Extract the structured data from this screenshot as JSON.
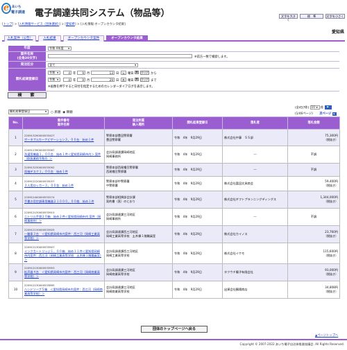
{
  "header": {
    "logo_letter": "e",
    "logo_small": "あいち",
    "logo_text": "電子調達",
    "system_title": "電子調達共同システム（物品等）",
    "font_larger": "文字を大きく",
    "font_standard": "標　準",
    "font_smaller": "文字を小さく"
  },
  "breadcrumbs": {
    "items": [
      "トップ",
      "入札情報サービス（団体選択）",
      "愛知県"
    ],
    "current": "入札情報-オープンカウンタ結果",
    "separator": " > "
  },
  "prefecture": "愛知県",
  "tabs": [
    "入札案件（公告）",
    "入札結果",
    "オープンカウンタ案件",
    "オープンカウンタ結果"
  ],
  "active_tab": 3,
  "form": {
    "nendo_label": "年度",
    "nendo_value": "令和 4年度",
    "case_name_label": "案件名称\n(全角30文字)",
    "case_name_note": "※前方一致で検索します。",
    "order_type_label": "発注区分",
    "order_type_value": "全て",
    "date_label": "開札結果登録日",
    "from": {
      "era": "令和",
      "year": "4",
      "month": "9",
      "day": "13",
      "weekday_label": "曜日",
      "weekday": "火"
    },
    "to": {
      "era": "令和",
      "year": "4",
      "month": "9",
      "day": "29",
      "weekday_label": "曜日",
      "weekday": "木"
    },
    "year_unit": "年",
    "month_unit": "月",
    "day_unit": "日",
    "clear": "クリア",
    "from_suffix": "から",
    "to_suffix": "まで",
    "calendar_note": "※画像を押下すると日付を指定するためのカレンダーダイアログを表示します。",
    "search_button": "検　索"
  },
  "sort": {
    "field": "開札結果登録日",
    "ascending": "昇順",
    "descending": "降順",
    "selected": "descending"
  },
  "pager": {
    "total_text": "(全457件)",
    "per_page": "10",
    "per_page_suffix": "件",
    "pages_text": "(1/46ページ)",
    "next": "次ページ"
  },
  "table": {
    "headers": {
      "no": "No.",
      "case": "案件番号\n案件名称",
      "org": "発注所属\n納入場所",
      "date": "開札結果登録日",
      "winner": "落札者",
      "amount": "落札金額"
    },
    "rows": [
      {
        "no": "1",
        "case_no": "220913290000533427",
        "name": "ポータブルカーナビゲーション３，００台　始め１件",
        "org": "警察本部豊田警察署",
        "place": "豊田警察署",
        "date": "令和　4年　9月29日",
        "winner": "株式会社中藤　ＳＳ部",
        "amount": "75,300円",
        "tax": "（税抜き）"
      },
      {
        "no": "2",
        "case_no": "220912390000533567",
        "name": "洗濯用機器１，００台　始め１件＜愛知県岡崎市内＞ 案件（取扱業務令和4）＞",
        "org": "会計局調達課岡崎地区",
        "place": "岡崎事務所",
        "date": "令和　4年　9月29日",
        "winner": "---",
        "amount": "不調",
        "tax": ""
      },
      {
        "no": "3",
        "case_no": "220913230000533092",
        "name": "両袖デスク１，００台　始め１件",
        "org": "警察本部西尾幡豆警察署",
        "place": "西尾幡豆警察署",
        "date": "令和　4年　9月29日",
        "winner": "---",
        "amount": "不調",
        "tax": ""
      },
      {
        "no": "4",
        "case_no": "220912120000533037",
        "name": "３人用ロッカー３，００台　始め１件",
        "org": "警察本部中警察署",
        "place": "中警察署",
        "date": "令和　4年　9月29日",
        "winner": "株式会社富田文具商会",
        "amount": "59,400円",
        "tax": "（税抜き）"
      },
      {
        "no": "5",
        "case_no": "220912400000533274",
        "name": "手書き用空調専用機器２１０００，００枚　始め１件",
        "org": "警察本部相撲部会計課",
        "place": "契約書（直）のとおり",
        "date": "令和　4年　9月29日",
        "winner": "株式会社ギフトプランニングディングス",
        "amount": "1,344,000円",
        "tax": "（税抜き）"
      },
      {
        "no": "6",
        "case_no": "220912130000533915",
        "name": "ニトリル手袋２０箱　始め２件＜愛知県岡崎市内 案件（岡崎事務所）＞",
        "org": "会計局調達課三河地区",
        "place": "岡崎事務所",
        "date": "令和　4年　9月29日",
        "winner": "---",
        "amount": "不調",
        "tax": ""
      },
      {
        "no": "7",
        "case_no": "220912130000533925",
        "name": "一輪車３台　＜愛知県岡崎市内案件：西三河（岡崎工業高等学校）＞",
        "org": "会計局調達課西三河地区",
        "place": "岡崎工業高等学校　土木棟１階職員室",
        "date": "令和　4年　9月29日",
        "winner": "株式会社カイノス",
        "amount": "23,760円",
        "tax": "（税抜き）"
      },
      {
        "no": "8",
        "case_no": "220912130000533907",
        "name": "インクカートリッジ１，００箱　始め１１件＜愛知県岡崎市内案件：西三河（岡崎工業高等学校　土木棟１階職員室）＞",
        "org": "会計局調達課西三河地区",
        "place": "岡崎工業高等学校",
        "date": "令和　4年　9月29日",
        "winner": "株式会社イケモ",
        "amount": "115,600円",
        "tax": "（税抜き）"
      },
      {
        "no": "9",
        "case_no": "220912130000533953",
        "name": "拡声器４台　＜愛知県岡崎市内案件：西三河（岡崎商業高等学校）＞",
        "org": "会計局調達課三河地区",
        "place": "岡崎商業高等学校",
        "date": "令和　4年　9月29日",
        "winner": "タクウチ電子有限会社",
        "amount": "93,000円",
        "tax": "（税抜き）"
      },
      {
        "no": "10",
        "case_no": "220912130000533895",
        "name": "ハンドソープ５箱　＜愛知県岡崎市内案件：西三河（岡崎商業高等学校）＞",
        "org": "会計局調達課三河地区",
        "place": "岡崎商業高等学校",
        "date": "令和　4年　9月29日",
        "winner": "出資会社鶴陽商店",
        "amount": "34,808円",
        "tax": "（税抜き）"
      }
    ]
  },
  "org_top_button": "団体のトップページへ戻る",
  "to_top_link": "▲ページトップへ",
  "copyright": "Copyright © 2007-2022 あいち電子自治体推進協議会. All Rights Reserved.",
  "colors": {
    "accent": "#9b5ed0",
    "link": "#1a3cc8",
    "row_alt": "#eaeaf8"
  }
}
